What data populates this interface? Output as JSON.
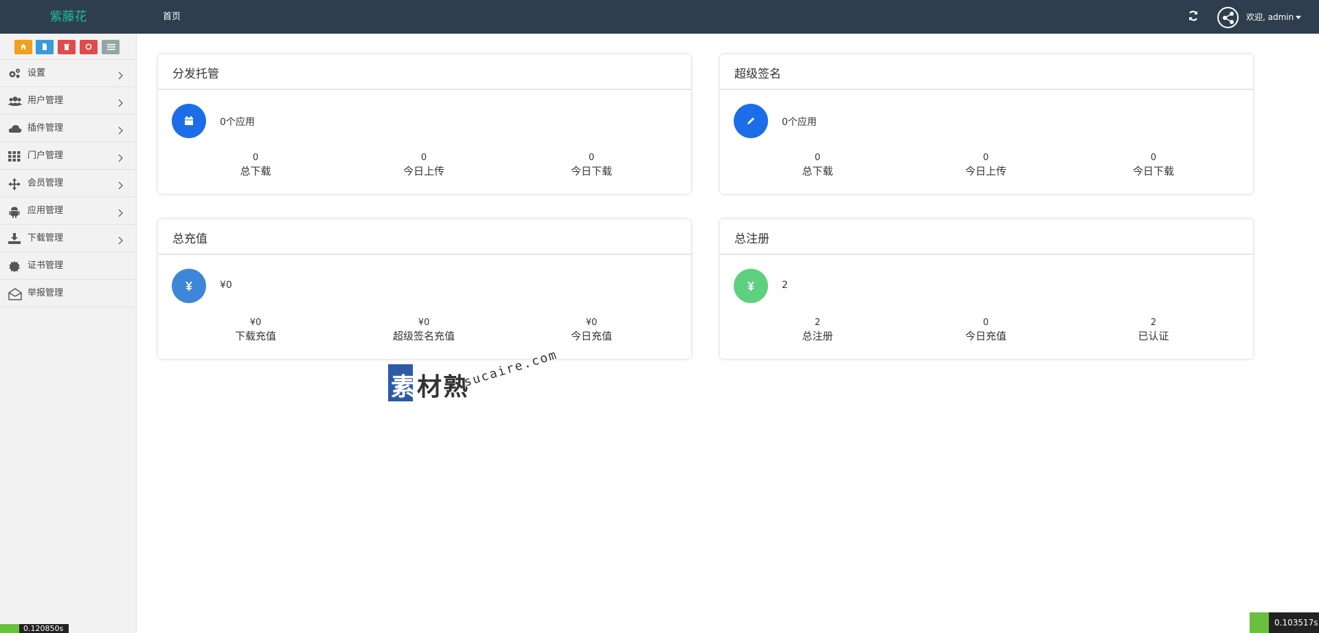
{
  "header": {
    "brand": "紫藤花",
    "nav_home": "首页",
    "welcome": "欢迎, admin",
    "refresh_icon": "refresh-icon",
    "avatar_icon": "share-avatar-icon"
  },
  "sidebar": {
    "quick_buttons": [
      {
        "icon": "home-icon",
        "color": "#f0a01c"
      },
      {
        "icon": "file-icon",
        "color": "#3b9ad9"
      },
      {
        "icon": "trash-icon",
        "color": "#e04b4b"
      },
      {
        "icon": "recycle-icon",
        "color": "#e04b4b"
      },
      {
        "icon": "list-icon",
        "color": "#95a5a6"
      }
    ],
    "items": [
      {
        "label": "设置",
        "icon": "gears-icon"
      },
      {
        "label": "用户管理",
        "icon": "users-icon"
      },
      {
        "label": "插件管理",
        "icon": "cloud-icon"
      },
      {
        "label": "门户管理",
        "icon": "grid-icon"
      },
      {
        "label": "会员管理",
        "icon": "move-icon"
      },
      {
        "label": "应用管理",
        "icon": "android-icon"
      },
      {
        "label": "下载管理",
        "icon": "download-icon"
      },
      {
        "label": "证书管理",
        "icon": "certificate-icon"
      },
      {
        "label": "举报管理",
        "icon": "envelope-open-icon"
      }
    ]
  },
  "cards": {
    "distribution": {
      "title": "分发托管",
      "main_value": "0个应用",
      "icon": "calendar-icon",
      "color": "#1c6ee8",
      "stats": [
        {
          "value": "0",
          "label": "总下载"
        },
        {
          "value": "0",
          "label": "今日上传"
        },
        {
          "value": "0",
          "label": "今日下载"
        }
      ]
    },
    "super_sign": {
      "title": "超级签名",
      "main_value": "0个应用",
      "icon": "pencil-icon",
      "color": "#1c6ee8",
      "stats": [
        {
          "value": "0",
          "label": "总下载"
        },
        {
          "value": "0",
          "label": "今日上传"
        },
        {
          "value": "0",
          "label": "今日下载"
        }
      ]
    },
    "recharge": {
      "title": "总充值",
      "main_value": "¥0",
      "icon": "yen-icon",
      "color": "#3d87d8",
      "stats": [
        {
          "value": "¥0",
          "label": "下载充值"
        },
        {
          "value": "¥0",
          "label": "超级签名充值"
        },
        {
          "value": "¥0",
          "label": "今日充值"
        }
      ]
    },
    "registration": {
      "title": "总注册",
      "main_value": "2",
      "icon": "yen-icon",
      "color": "#5fcf80",
      "stats": [
        {
          "value": "2",
          "label": "总注册"
        },
        {
          "value": "0",
          "label": "今日充值"
        },
        {
          "value": "2",
          "label": "已认证"
        }
      ]
    }
  },
  "watermark": {
    "cn_first": "素",
    "cn_rest": "材熟",
    "en": "sucaire.com"
  },
  "debug": {
    "left_time": "0.120850s",
    "right_time": "0.103517s"
  }
}
